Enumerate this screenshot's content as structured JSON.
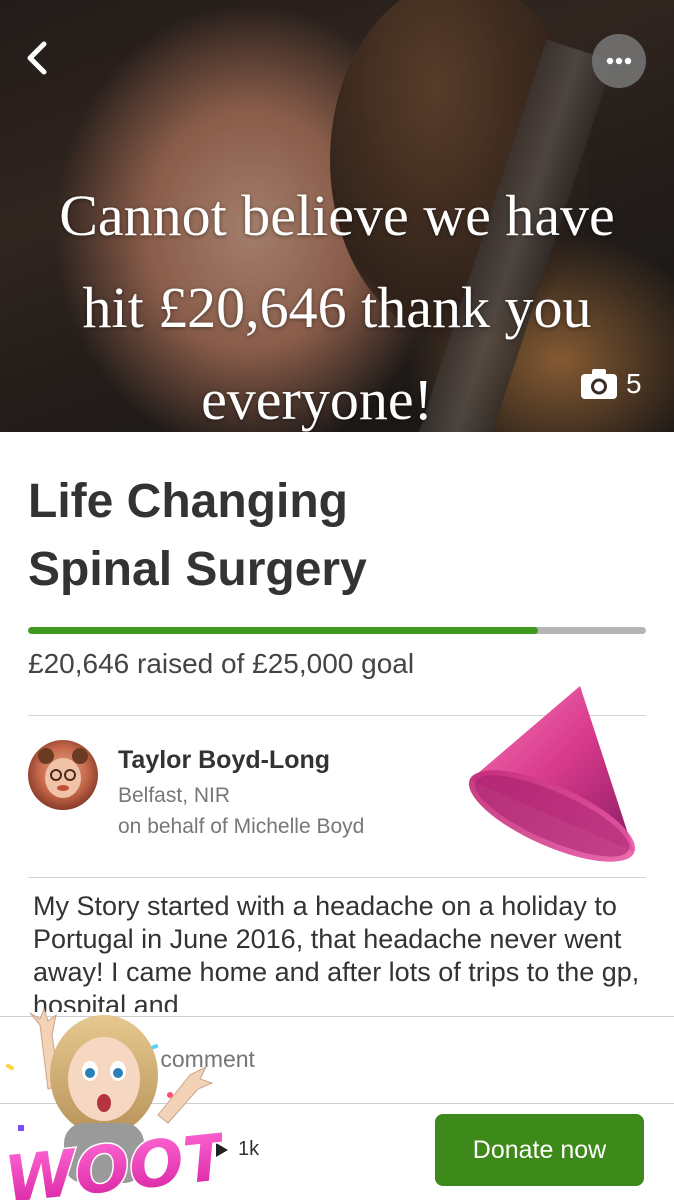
{
  "hero": {
    "caption_lines": [
      "Cannot believe we have",
      "hit £20,646 thank you",
      "everyone!"
    ],
    "photo_count": "5"
  },
  "campaign": {
    "title_lines": [
      "Life Changing",
      "Spinal Surgery"
    ],
    "raised_text": "£20,646 raised of £25,000 goal",
    "progress_fraction": 0.826,
    "progress_color": "#3d9a1e"
  },
  "organizer": {
    "name": "Taylor Boyd-Long",
    "location": "Belfast, NIR",
    "behalf": "on behalf of Michelle Boyd"
  },
  "story": {
    "text": "My Story started with a headache on a holiday to Portugal in June 2016, that headache never went away! I came home and after lots of trips to the gp, hospital and"
  },
  "comment": {
    "placeholder": "e a comment"
  },
  "footer": {
    "share_count": "1k",
    "donate_label": "Donate now",
    "donate_color": "#3d8a1a"
  },
  "sticker": {
    "text": "WOOT!"
  },
  "icons": [
    "chevron-left-icon",
    "more-icon",
    "camera-icon",
    "party-hat-icon",
    "share-arrow-icon"
  ]
}
